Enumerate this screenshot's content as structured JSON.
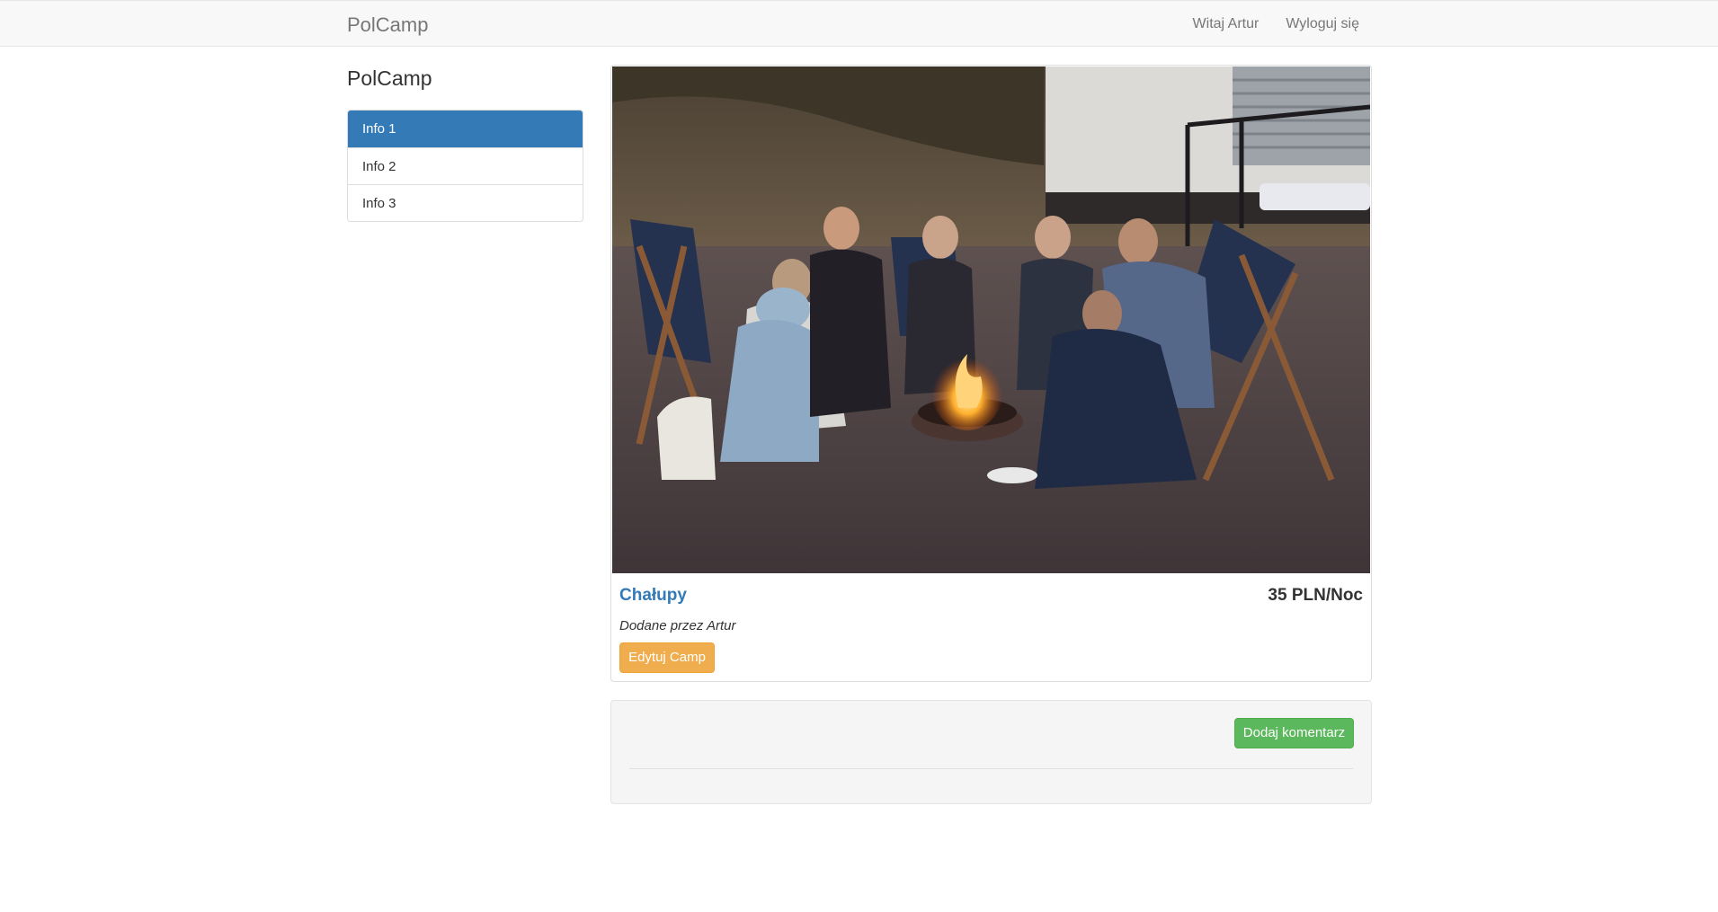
{
  "navbar": {
    "brand": "PolCamp",
    "greeting": "Witaj Artur",
    "logout": "Wyloguj się"
  },
  "sidebar": {
    "title": "PolCamp",
    "items": [
      {
        "label": "Info 1",
        "active": true
      },
      {
        "label": "Info 2",
        "active": false
      },
      {
        "label": "Info 3",
        "active": false
      }
    ]
  },
  "camp": {
    "name": "Chałupy",
    "price": "35 PLN/Noc",
    "author": "Dodane przez Artur",
    "edit_label": "Edytuj Camp"
  },
  "comments": {
    "add_label": "Dodaj komentarz"
  },
  "colors": {
    "primary": "#337ab7",
    "warning": "#f0ad4e",
    "success": "#5cb85c",
    "navbar_bg": "#f8f8f8"
  }
}
